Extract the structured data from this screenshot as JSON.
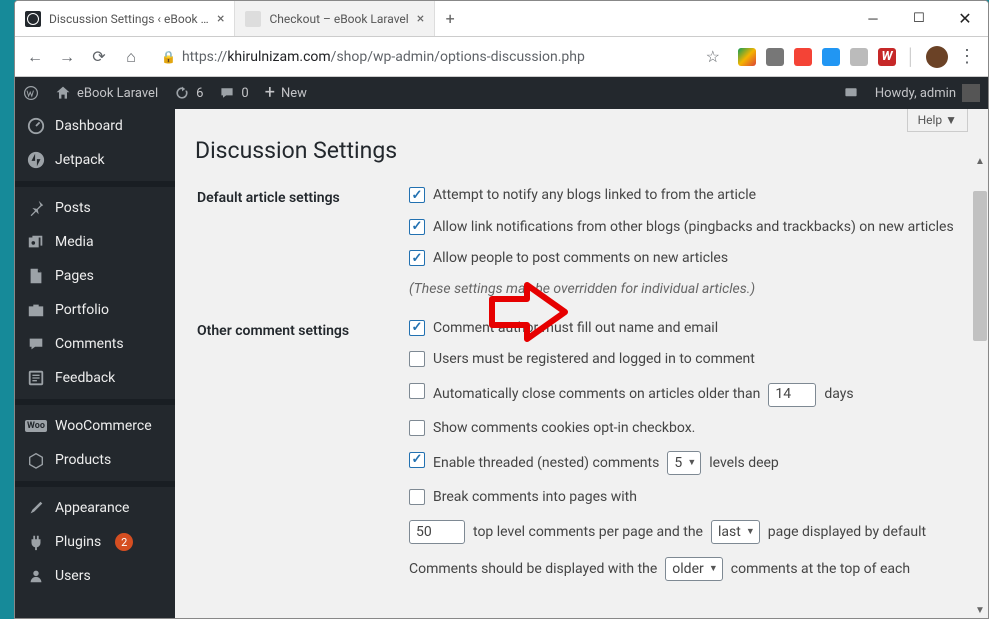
{
  "browser": {
    "tabs": [
      {
        "title": "Discussion Settings ‹ eBook Lara…",
        "active": true
      },
      {
        "title": "Checkout – eBook Laravel",
        "active": false
      }
    ],
    "url_prefix": "https://",
    "url_host": "khirulnizam.com",
    "url_path": "/shop/wp-admin/options-discussion.php"
  },
  "adminbar": {
    "site": "eBook Laravel",
    "updates": "6",
    "comments": "0",
    "new": "New",
    "howdy": "Howdy, admin"
  },
  "sidebar": {
    "items": [
      {
        "label": "Dashboard",
        "icon": "dashboard"
      },
      {
        "label": "Jetpack",
        "icon": "jetpack"
      },
      {
        "sep": true
      },
      {
        "label": "Posts",
        "icon": "pin"
      },
      {
        "label": "Media",
        "icon": "media"
      },
      {
        "label": "Pages",
        "icon": "page"
      },
      {
        "label": "Portfolio",
        "icon": "portfolio"
      },
      {
        "label": "Comments",
        "icon": "comments"
      },
      {
        "label": "Feedback",
        "icon": "feedback"
      },
      {
        "sep": true
      },
      {
        "label": "WooCommerce",
        "icon": "woo"
      },
      {
        "label": "Products",
        "icon": "products"
      },
      {
        "sep": true
      },
      {
        "label": "Appearance",
        "icon": "appearance"
      },
      {
        "label": "Plugins",
        "icon": "plugins",
        "badge": "2"
      },
      {
        "label": "Users",
        "icon": "users"
      }
    ]
  },
  "page": {
    "help": "Help ▼",
    "title": "Discussion Settings",
    "section1_title": "Default article settings",
    "opt1": "Attempt to notify any blogs linked to from the article",
    "opt2": "Allow link notifications from other blogs (pingbacks and trackbacks) on new articles",
    "opt3": "Allow people to post comments on new articles",
    "hint1": "(These settings may be overridden for individual articles.)",
    "section2_title": "Other comment settings",
    "opt4": "Comment author must fill out name and email",
    "opt5": "Users must be registered and logged in to comment",
    "opt6a": "Automatically close comments on articles older than",
    "opt6_days": "14",
    "opt6b": "days",
    "opt7": "Show comments cookies opt-in checkbox.",
    "opt8a": "Enable threaded (nested) comments",
    "opt8_levels": "5",
    "opt8b": "levels deep",
    "opt9": "Break comments into pages with",
    "opt10_count": "50",
    "opt10a": "top level comments per page and the",
    "opt10_sel": "last",
    "opt10b": "page displayed by default",
    "opt11a": "Comments should be displayed with the",
    "opt11_sel": "older",
    "opt11b": "comments at the top of each"
  }
}
